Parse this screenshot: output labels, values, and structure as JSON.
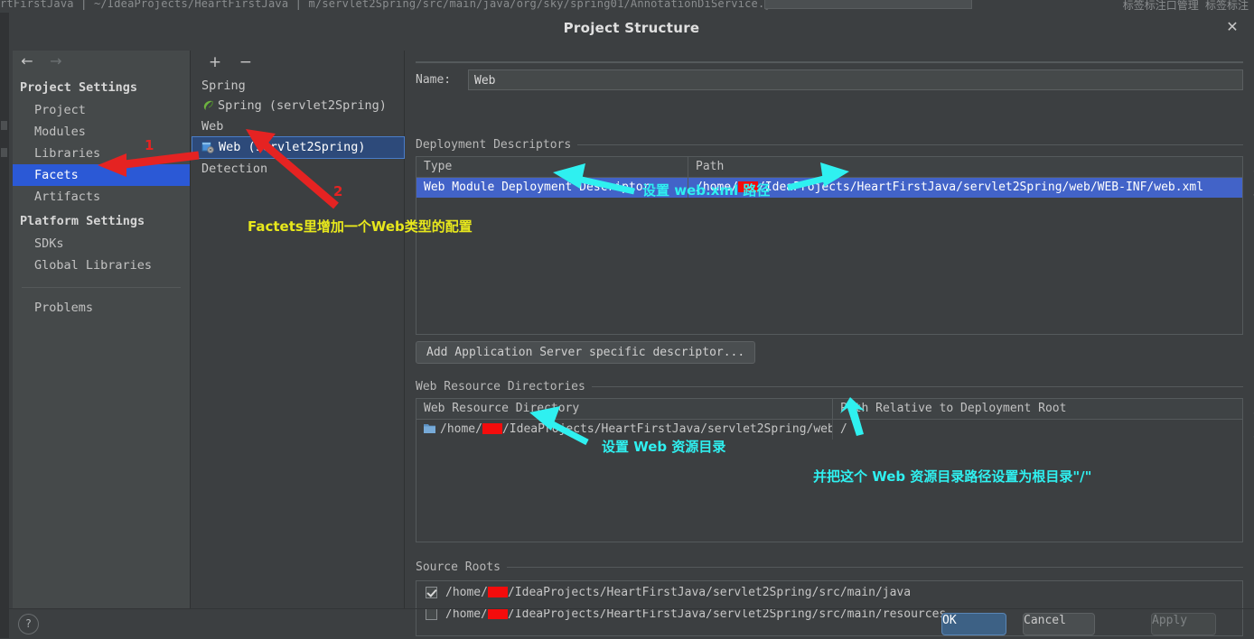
{
  "background": {
    "breadcrumb": "rtFirstJava | ~/IdeaProjects/HeartFirstJava | m/servlet2Spring/src/main/java/org/sky/spring01/AnnotationDiService.j",
    "right_text": "标签标注口管理   标签标注"
  },
  "dialog": {
    "title": "Project Structure",
    "close_icon": "close-icon"
  },
  "sidebar": {
    "back_icon": "arrow-left-icon",
    "forward_icon": "arrow-right-icon",
    "sections": [
      {
        "header": "Project Settings",
        "items": [
          {
            "label": "Project",
            "selected": false
          },
          {
            "label": "Modules",
            "selected": false
          },
          {
            "label": "Libraries",
            "selected": false
          },
          {
            "label": "Facets",
            "selected": true
          },
          {
            "label": "Artifacts",
            "selected": false
          }
        ]
      },
      {
        "header": "Platform Settings",
        "items": [
          {
            "label": "SDKs",
            "selected": false
          },
          {
            "label": "Global Libraries",
            "selected": false
          }
        ]
      }
    ],
    "problems_label": "Problems"
  },
  "facets": {
    "add_icon": "plus-icon",
    "remove_icon": "minus-icon",
    "tree": [
      {
        "type": "group",
        "label": "Spring"
      },
      {
        "type": "item",
        "label": "Spring (servlet2Spring)",
        "icon": "spring-leaf-icon",
        "selected": false
      },
      {
        "type": "group",
        "label": "Web"
      },
      {
        "type": "item",
        "label": "Web (servlet2Spring)",
        "icon": "web-module-icon",
        "selected": true
      },
      {
        "type": "group",
        "label": "Detection"
      }
    ]
  },
  "detail": {
    "name_label": "Name:",
    "name_value": "Web",
    "deployment": {
      "group_title": "Deployment Descriptors",
      "columns": [
        "Type",
        "Path"
      ],
      "rows": [
        {
          "type": "Web Module Deployment Descriptor",
          "path_prefix": "/home/",
          "path_suffix": "/IdeaProjects/HeartFirstJava/servlet2Spring/web/WEB-INF/web.xml",
          "selected": true
        }
      ],
      "buttons": [
        {
          "icon": "plus-icon",
          "name": "add-descriptor-button",
          "dim": false
        },
        {
          "icon": "minus-icon",
          "name": "remove-descriptor-button",
          "dim": false
        },
        {
          "icon": "pencil-icon",
          "name": "edit-descriptor-button",
          "dim": false
        }
      ]
    },
    "add_server_descriptor_label": "Add Application Server specific descriptor...",
    "web_resources": {
      "group_title": "Web Resource Directories",
      "columns": [
        "Web Resource Directory",
        "Path Relative to Deployment Root"
      ],
      "rows": [
        {
          "icon": "folder-icon",
          "dir_prefix": "/home/",
          "dir_suffix": "/IdeaProjects/HeartFirstJava/servlet2Spring/web",
          "relative": "/"
        }
      ],
      "buttons": [
        {
          "icon": "plus-icon",
          "name": "add-web-resource-button",
          "dim": false
        },
        {
          "icon": "minus-icon",
          "name": "remove-web-resource-button",
          "dim": true
        },
        {
          "icon": "pencil-icon",
          "name": "edit-web-resource-button",
          "dim": true
        },
        {
          "icon": "question-icon",
          "name": "web-resource-help-button",
          "dim": false
        }
      ]
    },
    "source_roots": {
      "group_title": "Source Roots",
      "rows": [
        {
          "checked": true,
          "prefix": "/home/",
          "suffix": "/IdeaProjects/HeartFirstJava/servlet2Spring/src/main/java"
        },
        {
          "checked": false,
          "prefix": "/home/",
          "suffix": "/IdeaProjects/HeartFirstJava/servlet2Spring/src/main/resources"
        }
      ]
    }
  },
  "footer": {
    "help_icon": "question-icon",
    "ok_label": "OK",
    "cancel_label": "Cancel",
    "apply_label": "Apply"
  },
  "annotations": {
    "marker_1": "1",
    "marker_2": "2",
    "yellow_note": "Factets里增加一个Web类型的配置",
    "cyan_webxml": "设置 web.xml 路径",
    "cyan_webres": "设置 Web 资源目录",
    "cyan_root": "并把这个 Web 资源目录路径设置为根目录\"/\""
  },
  "colors": {
    "accent_blue": "#2b59d6",
    "row_select_blue": "#4263c8",
    "annotation_cyan": "#2ff0f0",
    "annotation_yellow": "#e8e81c",
    "annotation_red": "#e52322",
    "dialog_bg": "#3c3f41"
  }
}
